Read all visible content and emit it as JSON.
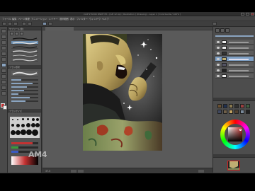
{
  "window": {
    "title": "CLIP STUDIO PAINT EX  -  [AM 12.lip]  [ Illustration ]  (Drawing)  -  Layer 1 [ ColorGuide / 100% ]"
  },
  "menu": {
    "items": [
      "ファイル",
      "編集",
      "ページ管理",
      "アニメーション",
      "レイヤー",
      "選択範囲",
      "表示",
      "フィルター",
      "ウィンドウ",
      "ヘルプ"
    ]
  },
  "subtool": {
    "header": "サブツール[筆]",
    "detail_header": "ブラシ形状",
    "brush_size_header": "ブラシサイズ"
  },
  "canvas": {
    "zoom": "37.5"
  },
  "watermark": "AM4",
  "colors": {
    "main": "#c43232",
    "sub": "#f0f0f0",
    "accent": "#7d9fc4"
  },
  "icons": [
    "pen-icon",
    "brush-icon",
    "eraser-icon",
    "fill-icon",
    "gradient-icon",
    "eyedropper-icon",
    "selection-icon",
    "move-icon",
    "text-icon",
    "hand-icon",
    "zoom-icon",
    "eye-icon",
    "layer-thumbnail"
  ]
}
